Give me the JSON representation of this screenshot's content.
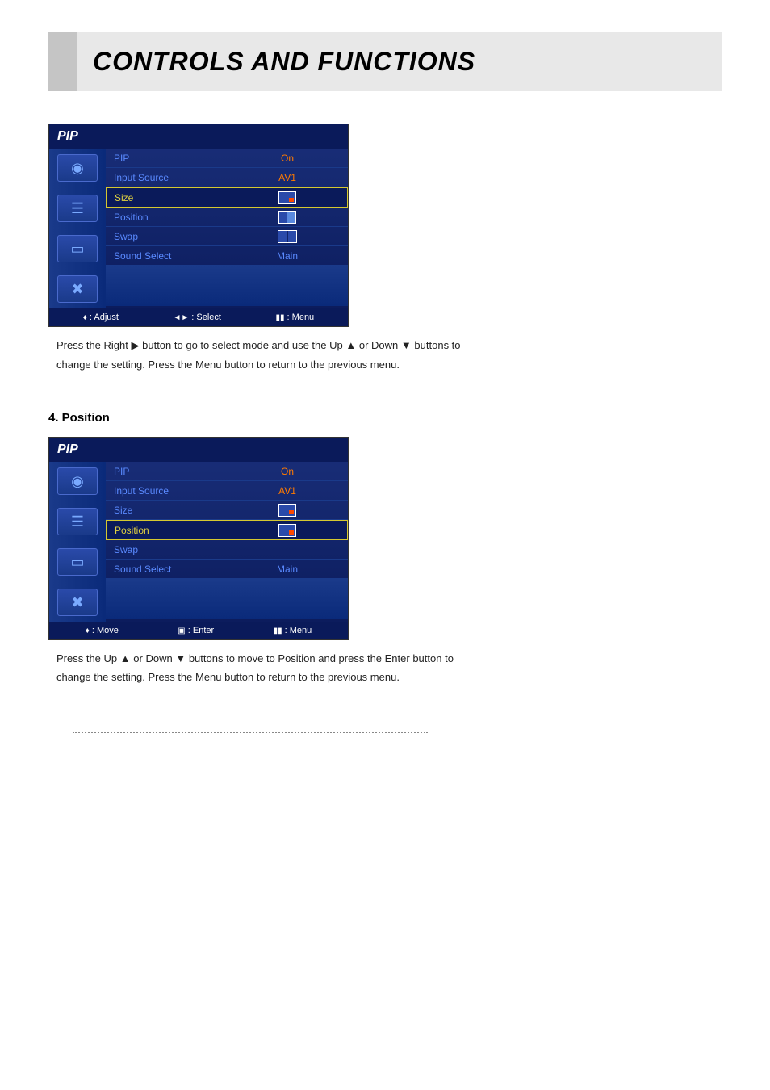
{
  "header": {
    "title": "CONTROLS AND FUNCTIONS"
  },
  "panel1": {
    "title": "PIP",
    "rows": [
      {
        "label": "PIP",
        "value": "On"
      },
      {
        "label": "Input Source",
        "value": "AV1"
      },
      {
        "label": "Size",
        "value": ""
      },
      {
        "label": "Position",
        "value": ""
      },
      {
        "label": "Swap",
        "value": ""
      },
      {
        "label": "Sound Select",
        "value": "Main"
      }
    ],
    "footer": {
      "left": ": Adjust",
      "mid": ": Select",
      "right": ": Menu"
    }
  },
  "instructions1": {
    "line1_a": "Press the Right",
    "line1_b": "button to go to select mode and use the Up",
    "line1_c": "or Down",
    "line1_d": "buttons to",
    "line2": "change the setting. Press the Menu button to return to the previous menu.",
    "arrows": {
      "right": "▶",
      "up": "▲",
      "down": "▼"
    }
  },
  "section2": {
    "heading": "4. Position"
  },
  "panel2": {
    "title": "PIP",
    "rows": [
      {
        "label": "PIP",
        "value": "On"
      },
      {
        "label": "Input Source",
        "value": "AV1"
      },
      {
        "label": "Size",
        "value": ""
      },
      {
        "label": "Position",
        "value": ""
      },
      {
        "label": "Swap",
        "value": ""
      },
      {
        "label": "Sound Select",
        "value": "Main"
      }
    ],
    "footer": {
      "left": ": Move",
      "mid": ": Enter",
      "right": ": Menu"
    }
  },
  "instructions2": {
    "line1_a": "Press the Up",
    "line1_b": "or Down",
    "line1_c": "buttons to move to Position and press the Enter button to",
    "line2": "change the setting. Press the Menu button to return to the previous menu.",
    "arrows": {
      "up": "▲",
      "down": "▼"
    }
  }
}
